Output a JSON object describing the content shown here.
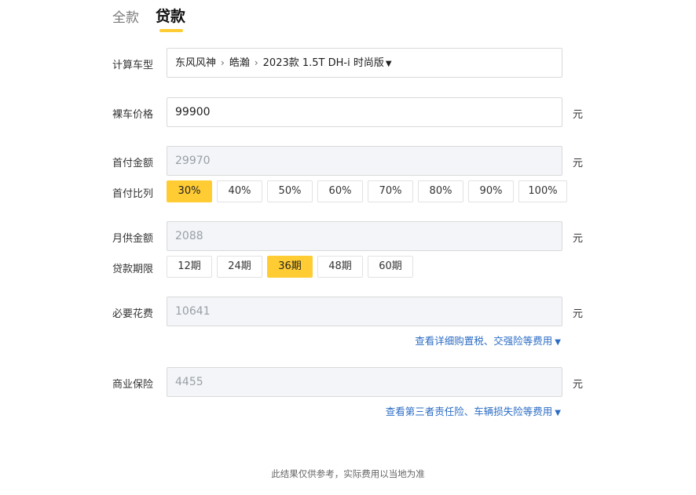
{
  "tabs": [
    {
      "label": "全款",
      "active": false
    },
    {
      "label": "贷款",
      "active": true
    }
  ],
  "accent_color": "#ffcc33",
  "link_color": "#2b6cc4",
  "model": {
    "label": "计算车型",
    "brand": "东风风神",
    "series": "皓瀚",
    "trim": "2023款 1.5T DH-i 时尚版"
  },
  "price": {
    "label": "裸车价格",
    "value": "99900",
    "unit": "元"
  },
  "down_payment": {
    "label": "首付金额",
    "value": "29970",
    "unit": "元"
  },
  "down_ratio": {
    "label": "首付比列",
    "options": [
      "30%",
      "40%",
      "50%",
      "60%",
      "70%",
      "80%",
      "90%",
      "100%"
    ],
    "selected": "30%"
  },
  "monthly": {
    "label": "月供金额",
    "value": "2088",
    "unit": "元"
  },
  "term": {
    "label": "贷款期限",
    "options": [
      "12期",
      "24期",
      "36期",
      "48期",
      "60期"
    ],
    "selected": "36期"
  },
  "required_fees": {
    "label": "必要花费",
    "value": "10641",
    "unit": "元",
    "link": "查看详细购置税、交强险等费用"
  },
  "insurance": {
    "label": "商业保险",
    "value": "4455",
    "unit": "元",
    "link": "查看第三者责任险、车辆损失险等费用"
  },
  "footnote": "此结果仅供参考，实际费用以当地为准"
}
